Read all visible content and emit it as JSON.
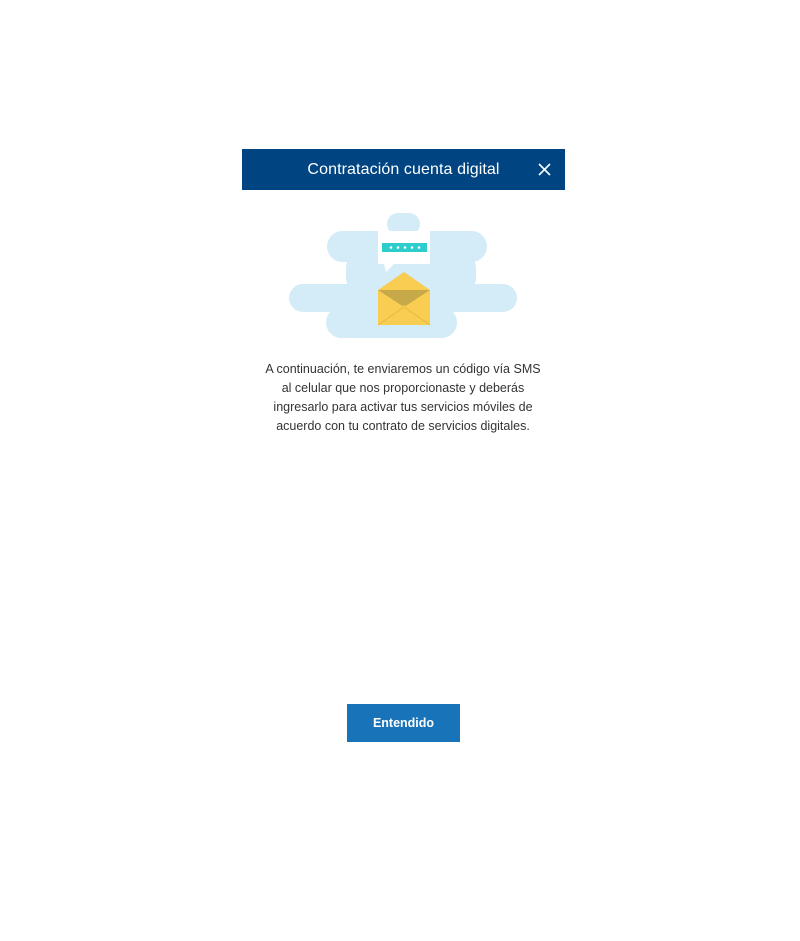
{
  "modal": {
    "title": "Contratación cuenta digital",
    "close_icon": "close-icon",
    "message": "A continuación, te enviaremos un código vía SMS al celular que nos proporcionaste y deberás ingresarlo para activar tus servicios móviles de acuerdo con tu contrato de servicios digitales.",
    "illustration_icon": "envelope-sms-illustration",
    "confirm_label": "Entendido"
  },
  "colors": {
    "header_bg": "#004481",
    "button_bg": "#1973b8",
    "cloud": "#d4ebf8",
    "envelope": "#f8cd51",
    "envelope_flap": "#c8a94a",
    "bubble_bar": "#2dcccd"
  }
}
